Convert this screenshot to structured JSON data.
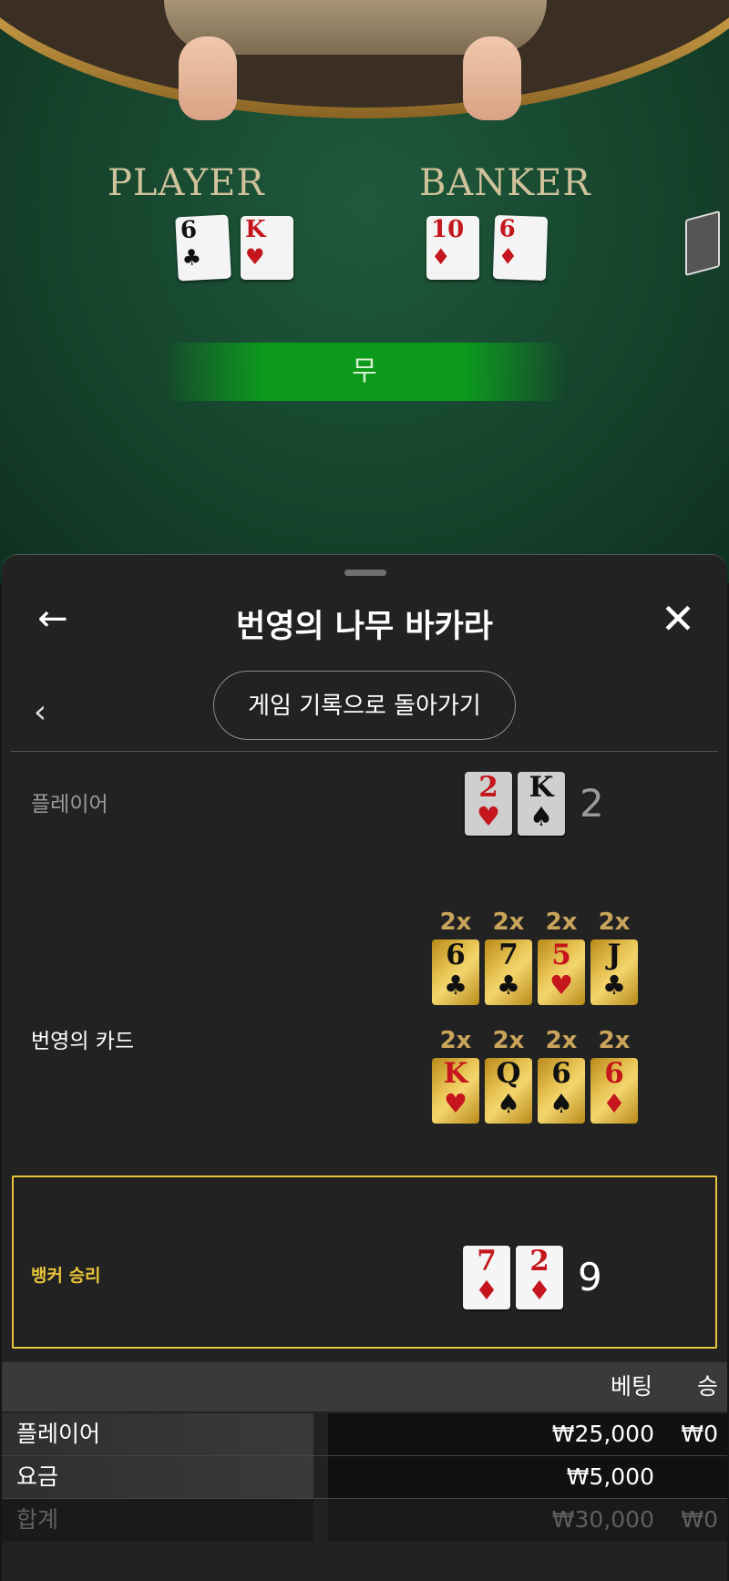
{
  "table": {
    "player_label": "PLAYER",
    "banker_label": "BANKER",
    "player_cards": [
      {
        "rank": "6",
        "suit": "♣",
        "color": "black"
      },
      {
        "rank": "K",
        "suit": "♥",
        "color": "red"
      }
    ],
    "banker_cards": [
      {
        "rank": "10",
        "suit": "♦",
        "color": "red"
      },
      {
        "rank": "6",
        "suit": "♦",
        "color": "red"
      }
    ],
    "result_text": "무"
  },
  "header": {
    "title": "번영의 나무 바카라",
    "back_icon": "←",
    "close_icon": "✕"
  },
  "nav": {
    "chevron_icon": "‹",
    "history_button": "게임 기록으로 돌아가기"
  },
  "rounds": {
    "player": {
      "label": "플레이어",
      "cards": [
        {
          "rank": "2",
          "suit": "♥",
          "color": "red"
        },
        {
          "rank": "K",
          "suit": "♠",
          "color": "black"
        }
      ],
      "score": "2"
    },
    "prosperity": {
      "label": "번영의 카드",
      "row1": [
        {
          "mult": "2x",
          "rank": "6",
          "suit": "♣",
          "color": "black"
        },
        {
          "mult": "2x",
          "rank": "7",
          "suit": "♣",
          "color": "black"
        },
        {
          "mult": "2x",
          "rank": "5",
          "suit": "♥",
          "color": "red"
        },
        {
          "mult": "2x",
          "rank": "J",
          "suit": "♣",
          "color": "black"
        }
      ],
      "row2": [
        {
          "mult": "2x",
          "rank": "K",
          "suit": "♥",
          "color": "red"
        },
        {
          "mult": "2x",
          "rank": "Q",
          "suit": "♠",
          "color": "black"
        },
        {
          "mult": "2x",
          "rank": "6",
          "suit": "♠",
          "color": "black"
        },
        {
          "mult": "2x",
          "rank": "6",
          "suit": "♦",
          "color": "red"
        }
      ]
    },
    "banker": {
      "label": "뱅커 승리",
      "cards": [
        {
          "rank": "7",
          "suit": "♦",
          "color": "red"
        },
        {
          "rank": "2",
          "suit": "♦",
          "color": "red"
        }
      ],
      "score": "9"
    }
  },
  "bets": {
    "col_bet": "베팅",
    "col_win": "승",
    "rows": [
      {
        "name": "플레이어",
        "bet": "₩25,000",
        "win": "₩0"
      },
      {
        "name": "요금",
        "bet": "₩5,000",
        "win": ""
      }
    ],
    "total": {
      "name": "합계",
      "bet": "₩30,000",
      "win": "₩0"
    }
  },
  "colors": {
    "accent_gold": "#e7c43a",
    "card_red": "#c4161c",
    "felt_green": "#1f5a3c",
    "result_green": "#0c9a1c"
  }
}
